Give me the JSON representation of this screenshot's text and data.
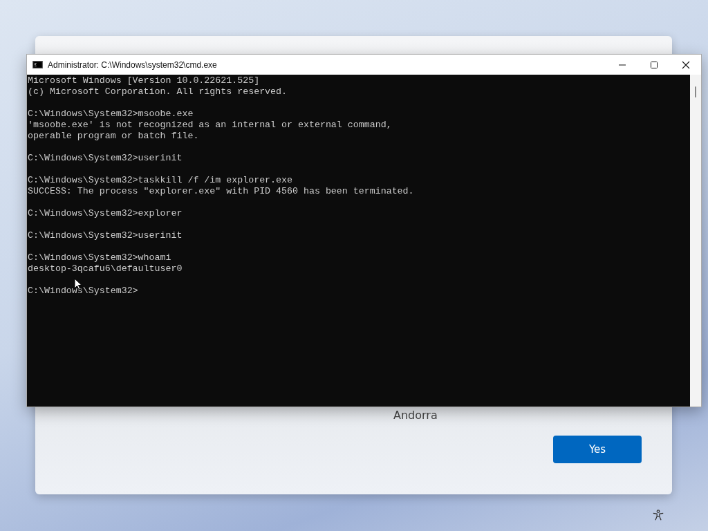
{
  "setup_card": {
    "region_text": "Andorra",
    "buttons": [
      "Yes"
    ]
  },
  "console_window": {
    "title": "Administrator: C:\\Windows\\system32\\cmd.exe",
    "blocks": [
      [
        "Microsoft Windows [Version 10.0.22621.525]",
        "(c) Microsoft Corporation. All rights reserved."
      ],
      [
        "C:\\Windows\\System32>msoobe.exe",
        "'msoobe.exe' is not recognized as an internal or external command,",
        "operable program or batch file."
      ],
      [
        "C:\\Windows\\System32>userinit"
      ],
      [
        "C:\\Windows\\System32>taskkill /f /im explorer.exe",
        "SUCCESS: The process \"explorer.exe\" with PID 4560 has been terminated."
      ],
      [
        "C:\\Windows\\System32>explorer"
      ],
      [
        "C:\\Windows\\System32>userinit"
      ],
      [
        "C:\\Windows\\System32>whoami",
        "desktop-3qcafu6\\defaultuser0"
      ],
      [
        "C:\\Windows\\System32>"
      ]
    ]
  }
}
